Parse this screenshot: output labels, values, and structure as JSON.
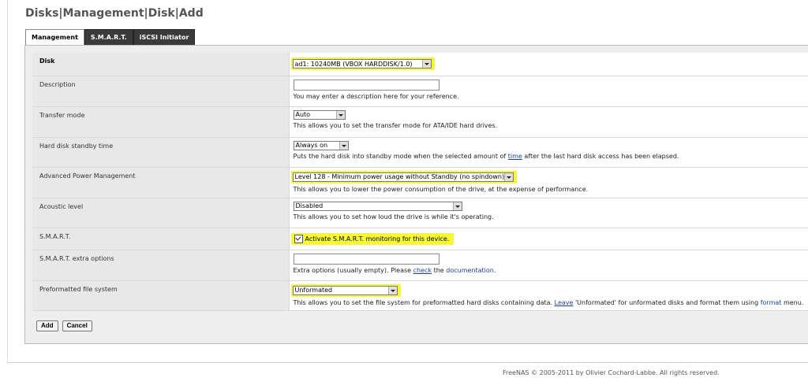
{
  "page": {
    "title": "Disks|Management|Disk|Add"
  },
  "tabs": [
    {
      "label": "Management",
      "active": true
    },
    {
      "label": "S.M.A.R.T.",
      "active": false
    },
    {
      "label": "iSCSI Initiator",
      "active": false
    }
  ],
  "form": {
    "disk": {
      "label": "Disk",
      "selected": "ad1: 10240MB (VBOX HARDDISK/1.0)"
    },
    "description": {
      "label": "Description",
      "value": "",
      "help": "You may enter a description here for your reference."
    },
    "transfer_mode": {
      "label": "Transfer mode",
      "selected": "Auto",
      "help": "This allows you to set the transfer mode for ATA/IDE hard drives."
    },
    "standby": {
      "label": "Hard disk standby time",
      "selected": "Always on",
      "help_before": "Puts the hard disk into standby mode when the selected amount of ",
      "help_link": "time",
      "help_after": " after the last hard disk access has been elapsed."
    },
    "apm": {
      "label": "Advanced Power Management",
      "selected": "Level 128 - Minimum power usage without Standby (no spindown)",
      "help": "This allows you to lower the power consumption of the drive, at the expense of performance."
    },
    "acoustic": {
      "label": "Acoustic level",
      "selected": "Disabled",
      "help": "This allows you to set how loud the drive is while it's operating."
    },
    "smart": {
      "label": "S.M.A.R.T.",
      "checked": true,
      "checkbox_label": "Activate S.M.A.R.T. monitoring for this device."
    },
    "smart_extra": {
      "label": "S.M.A.R.T. extra options",
      "value": "",
      "help_before": "Extra options (usually empty). Please ",
      "help_link1": "check",
      "help_mid": " the ",
      "help_link2": "documentation",
      "help_after": "."
    },
    "fs": {
      "label": "Preformatted file system",
      "selected": "Unformated",
      "help_before": "This allows you to set the file system for preformatted hard disks containing data. ",
      "help_link1": "Leave",
      "help_mid": " 'Unformated' for unformated disks and format them using ",
      "help_link2": "format",
      "help_after": " menu."
    }
  },
  "buttons": {
    "add": "Add",
    "cancel": "Cancel"
  },
  "footer": {
    "text": "FreeNAS © 2005-2011 by Olivier Cochard-Labbe. All rights reserved."
  },
  "colors": {
    "highlight": "#f7f733",
    "tab_dark": "#3a3a3a",
    "link": "#1a3f9e"
  }
}
